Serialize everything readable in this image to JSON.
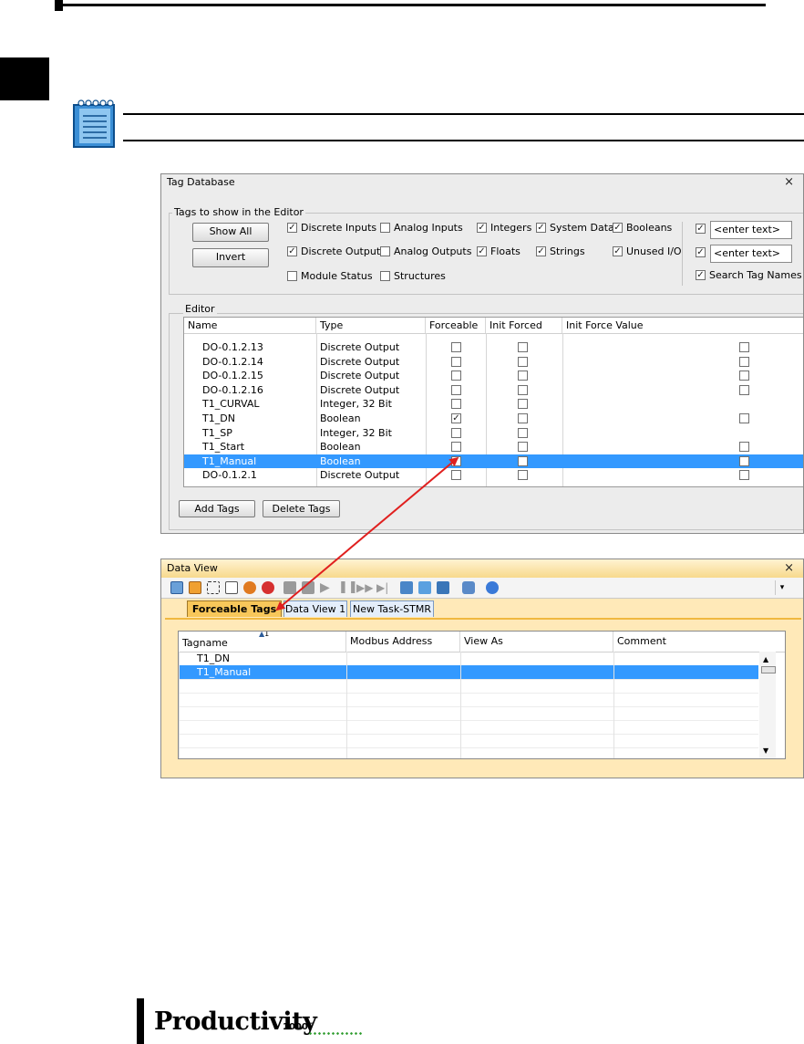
{
  "tag_database": {
    "title": "Tag Database",
    "filter_group_label": "Tags to show in the Editor",
    "show_all_label": "Show All",
    "invert_label": "Invert",
    "filters": [
      {
        "label": "Discrete Inputs",
        "checked": true
      },
      {
        "label": "Analog Inputs",
        "checked": false
      },
      {
        "label": "Integers",
        "checked": true
      },
      {
        "label": "System Data",
        "checked": true
      },
      {
        "label": "Booleans",
        "checked": true
      },
      {
        "label": "Discrete Outputs",
        "checked": true
      },
      {
        "label": "Analog Outputs",
        "checked": false
      },
      {
        "label": "Floats",
        "checked": true
      },
      {
        "label": "Strings",
        "checked": true
      },
      {
        "label": "Unused I/O",
        "checked": true
      },
      {
        "label": "Module Status",
        "checked": false
      },
      {
        "label": "Structures",
        "checked": false
      }
    ],
    "search_field_1": "<enter text>",
    "search_field_2": "<enter text>",
    "search_tag_names_label": "Search Tag Names",
    "editor_label": "Editor",
    "columns": [
      "Name",
      "Type",
      "Forceable",
      "Init Forced",
      "Init Force Value"
    ],
    "rows": [
      {
        "name": "DO-0.1.2.13",
        "type": "Discrete Output",
        "forceable": false,
        "init_forced": false,
        "value_box": true,
        "selected": false
      },
      {
        "name": "DO-0.1.2.14",
        "type": "Discrete Output",
        "forceable": false,
        "init_forced": false,
        "value_box": true,
        "selected": false
      },
      {
        "name": "DO-0.1.2.15",
        "type": "Discrete Output",
        "forceable": false,
        "init_forced": false,
        "value_box": true,
        "selected": false
      },
      {
        "name": "DO-0.1.2.16",
        "type": "Discrete Output",
        "forceable": false,
        "init_forced": false,
        "value_box": true,
        "selected": false
      },
      {
        "name": "T1_CURVAL",
        "type": "Integer, 32 Bit",
        "forceable": false,
        "init_forced": false,
        "value_box": false,
        "selected": false
      },
      {
        "name": "T1_DN",
        "type": "Boolean",
        "forceable": true,
        "init_forced": false,
        "value_box": true,
        "selected": false
      },
      {
        "name": "T1_SP",
        "type": "Integer, 32 Bit",
        "forceable": false,
        "init_forced": false,
        "value_box": false,
        "selected": false
      },
      {
        "name": "T1_Start",
        "type": "Boolean",
        "forceable": false,
        "init_forced": false,
        "value_box": true,
        "selected": false
      },
      {
        "name": "T1_Manual",
        "type": "Boolean",
        "forceable": true,
        "init_forced": false,
        "value_box": true,
        "selected": true
      },
      {
        "name": "DO-0.1.2.1",
        "type": "Discrete Output",
        "forceable": false,
        "init_forced": false,
        "value_box": true,
        "selected": false
      }
    ],
    "add_tags_label": "Add Tags",
    "delete_tags_label": "Delete Tags"
  },
  "data_view": {
    "title": "Data View",
    "tabs": [
      "Forceable Tags",
      "Data View 1",
      "New Task-STMR"
    ],
    "sort_indicator": "1",
    "columns": [
      "Tagname",
      "Modbus Address",
      "View As",
      "Comment"
    ],
    "rows": [
      "T1_DN",
      "T1_Manual"
    ]
  },
  "footer": {
    "brand": "Productivity",
    "brand_suffix": "1000",
    "tm": "™"
  },
  "colors": {
    "selection": "#3399ff",
    "active_tab": "#f8c75a",
    "arrow": "#e0201f",
    "logo_dots": "#2a9a2a"
  }
}
